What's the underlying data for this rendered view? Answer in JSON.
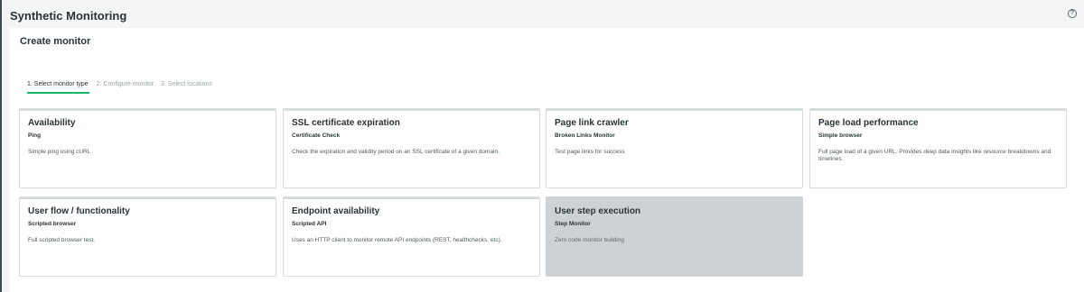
{
  "app": {
    "title": "Synthetic Monitoring",
    "help_icon": "?"
  },
  "panel": {
    "title": "Create monitor",
    "steps": [
      {
        "label": "1. Select monitor type",
        "active": true
      },
      {
        "label": "2. Configure monitor",
        "active": false
      },
      {
        "label": "3. Select locations",
        "active": false
      }
    ]
  },
  "monitor_types": [
    {
      "title": "Availability",
      "subtitle": "Ping",
      "description": "Simple ping using cURL",
      "selected": false
    },
    {
      "title": "SSL certificate expiration",
      "subtitle": "Certificate Check",
      "description": "Check the expiration and validity period on an SSL certificate of a given domain.",
      "selected": false
    },
    {
      "title": "Page link crawler",
      "subtitle": "Broken Links Monitor",
      "description": "Test page links for success",
      "selected": false
    },
    {
      "title": "Page load performance",
      "subtitle": "Simple browser",
      "description": "Full page load of a given URL. Provides deep data insights like resource breakdowns and timelines.",
      "selected": false
    },
    {
      "title": "User flow / functionality",
      "subtitle": "Scripted browser",
      "description": "Full scripted browser test.",
      "selected": false
    },
    {
      "title": "Endpoint availability",
      "subtitle": "Scripted API",
      "description": "Uses an HTTP client to monitor remote API endpoints (REST, healthchecks, etc).",
      "selected": false
    },
    {
      "title": "User step execution",
      "subtitle": "Step Monitor",
      "description": "Zero code monitor building",
      "selected": true
    }
  ],
  "colors": {
    "accent": "#18b56b",
    "selected_card": "#ced2d4"
  }
}
